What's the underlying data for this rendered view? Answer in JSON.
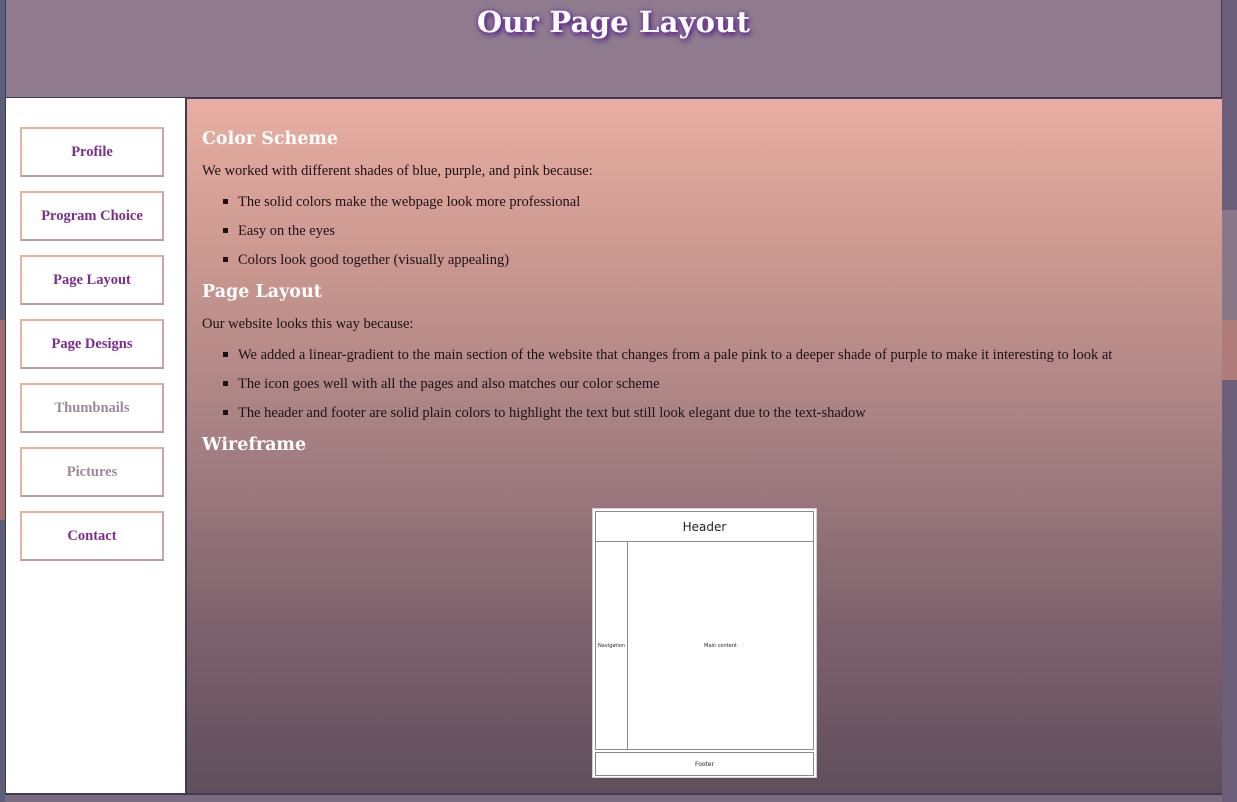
{
  "header": {
    "title": "Our Page Layout"
  },
  "nav": {
    "items": [
      {
        "label": "Profile",
        "state": "active"
      },
      {
        "label": "Program Choice",
        "state": "active"
      },
      {
        "label": "Page Layout",
        "state": "active"
      },
      {
        "label": "Page Designs",
        "state": "active"
      },
      {
        "label": "Thumbnails",
        "state": "muted"
      },
      {
        "label": "Pictures",
        "state": "muted"
      },
      {
        "label": "Contact",
        "state": "active"
      }
    ]
  },
  "main": {
    "color_scheme": {
      "heading": "Color Scheme",
      "intro": "We worked with different shades of blue, purple, and pink because:",
      "bullets": [
        "The solid colors make the webpage look more professional",
        "Easy on the eyes",
        "Colors look good together (visually appealing)"
      ]
    },
    "page_layout": {
      "heading": "Page Layout",
      "intro": "Our website looks this way because:",
      "bullets": [
        "We added a linear-gradient to the main section of the website that changes from a pale pink to a deeper shade of purple to make it interesting to look at",
        "The icon goes well with all the pages and also matches our color scheme",
        "The header and footer are solid plain colors to highlight the text but still look elegant due to the text-shadow"
      ]
    },
    "wireframe": {
      "heading": "Wireframe",
      "header_label": "Header",
      "nav_label": "Navigation",
      "main_label": "Main content",
      "footer_label": "Footer"
    }
  },
  "colors": {
    "header_bg": "#907b8e",
    "nav_text": "#7a2f8e",
    "nav_border": "#e3b3a4",
    "gradient_top": "#e9aea1",
    "gradient_bottom": "#5f4e5c"
  }
}
